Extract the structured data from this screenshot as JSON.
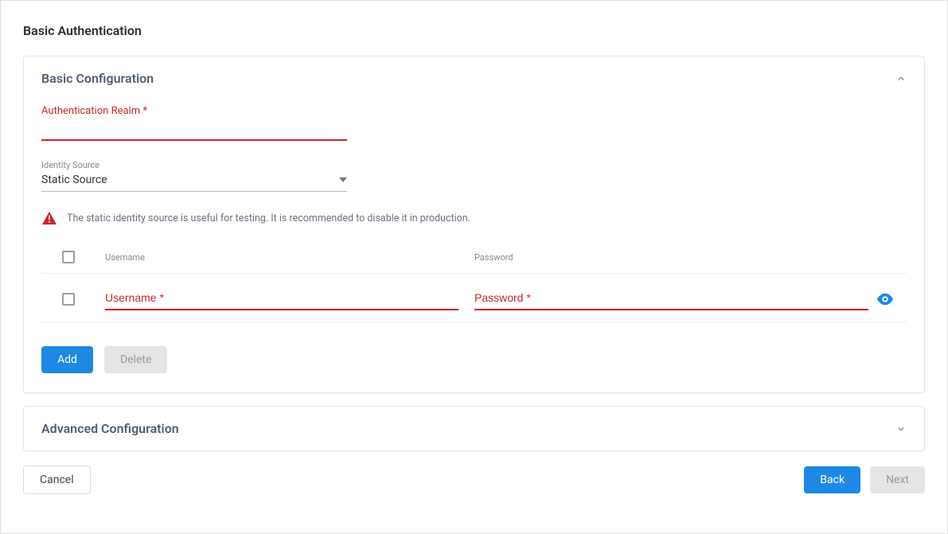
{
  "page": {
    "title": "Basic Authentication"
  },
  "basic": {
    "title": "Basic Configuration",
    "realm_label": "Authentication Realm *",
    "realm_value": "",
    "identity_label": "Identity Source",
    "identity_value": "Static Source",
    "warning_text": "The static identity source is useful for testing. It is recommended to disable it in production.",
    "table": {
      "header_username": "Username",
      "header_password": "Password",
      "row": {
        "username_placeholder": "Username *",
        "password_placeholder": "Password *",
        "username_value": "",
        "password_value": ""
      }
    },
    "buttons": {
      "add": "Add",
      "delete": "Delete"
    }
  },
  "advanced": {
    "title": "Advanced Configuration"
  },
  "footer": {
    "cancel": "Cancel",
    "back": "Back",
    "next": "Next"
  }
}
